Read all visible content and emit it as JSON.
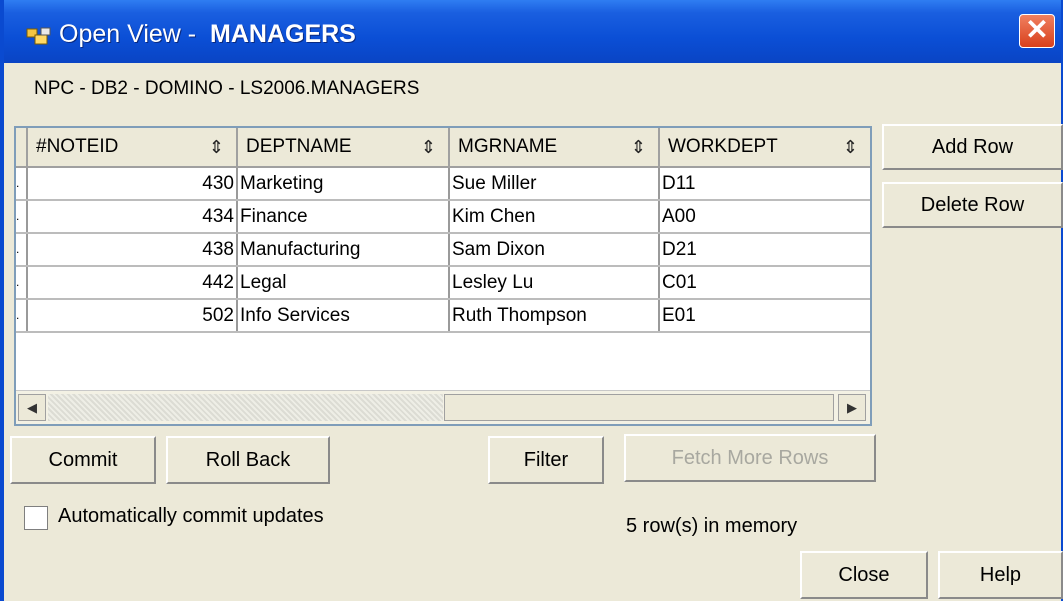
{
  "window": {
    "title_prefix": "Open View - ",
    "title_name": "MANAGERS",
    "close_glyph": "✕",
    "icon": "open-view-icon"
  },
  "connection": "NPC - DB2 - DOMINO - LS2006.MANAGERS",
  "table": {
    "sort_glyph": "⇕",
    "columns": [
      "#NOTEID",
      "DEPTNAME",
      "MGRNAME",
      "WORKDEPT"
    ],
    "rows": [
      {
        "marker": ".",
        "noteid": "430",
        "deptname": "Marketing",
        "mgrname": "Sue Miller",
        "workdept": "D11"
      },
      {
        "marker": ".",
        "noteid": "434",
        "deptname": "Finance",
        "mgrname": "Kim Chen",
        "workdept": "A00"
      },
      {
        "marker": ".",
        "noteid": "438",
        "deptname": "Manufacturing",
        "mgrname": "Sam Dixon",
        "workdept": "D21"
      },
      {
        "marker": ".",
        "noteid": "442",
        "deptname": "Legal",
        "mgrname": "Lesley Lu",
        "workdept": "C01"
      },
      {
        "marker": ".",
        "noteid": "502",
        "deptname": "Info Services",
        "mgrname": "Ruth Thompson",
        "workdept": "E01"
      }
    ],
    "scroll_left": "◀",
    "scroll_right": "▶"
  },
  "buttons": {
    "add_row": "Add Row",
    "delete_row": "Delete Row",
    "commit": "Commit",
    "roll_back": "Roll Back",
    "filter": "Filter",
    "fetch_more": "Fetch More Rows",
    "close": "Close",
    "help": "Help"
  },
  "auto_commit": {
    "label": "Automatically commit updates",
    "checked": false
  },
  "status": "5 row(s) in memory"
}
